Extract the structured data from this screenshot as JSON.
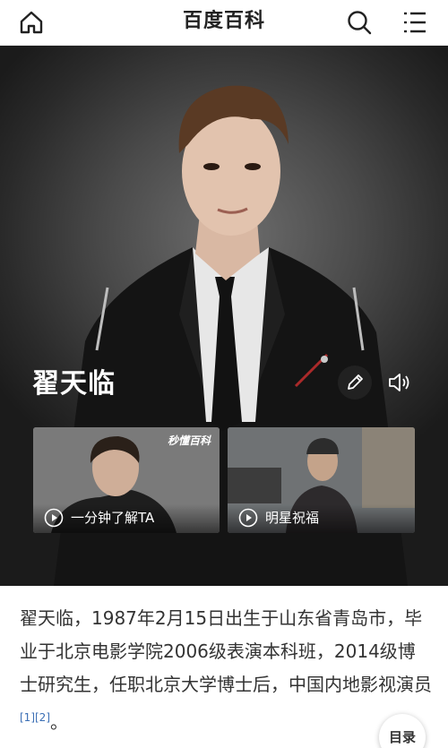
{
  "header": {
    "title": "百度百科",
    "icons": {
      "home": "home-icon",
      "search": "search-icon",
      "menu": "menu-icon"
    }
  },
  "hero": {
    "name": "翟天临",
    "edit_icon": "pencil-icon",
    "sound_icon": "speaker-icon",
    "videos": [
      {
        "caption": "一分钟了解TA",
        "logo": "秒懂百科",
        "icon": "play-icon"
      },
      {
        "caption": "明星祝福",
        "icon": "play-icon"
      }
    ]
  },
  "summary": {
    "text": "翟天临，1987年2月15日出生于山东省青岛市，毕业于北京电影学院2006级表演本科班，2014级博士研究生，任职北京大学博士后，中国内地影视演员",
    "refs": "[1][2]",
    "end": "。"
  },
  "toc_button": {
    "label": "目录"
  },
  "colors": {
    "link": "#3b6fb5",
    "text": "#333333",
    "hero_bg": "#2a2a2a"
  }
}
